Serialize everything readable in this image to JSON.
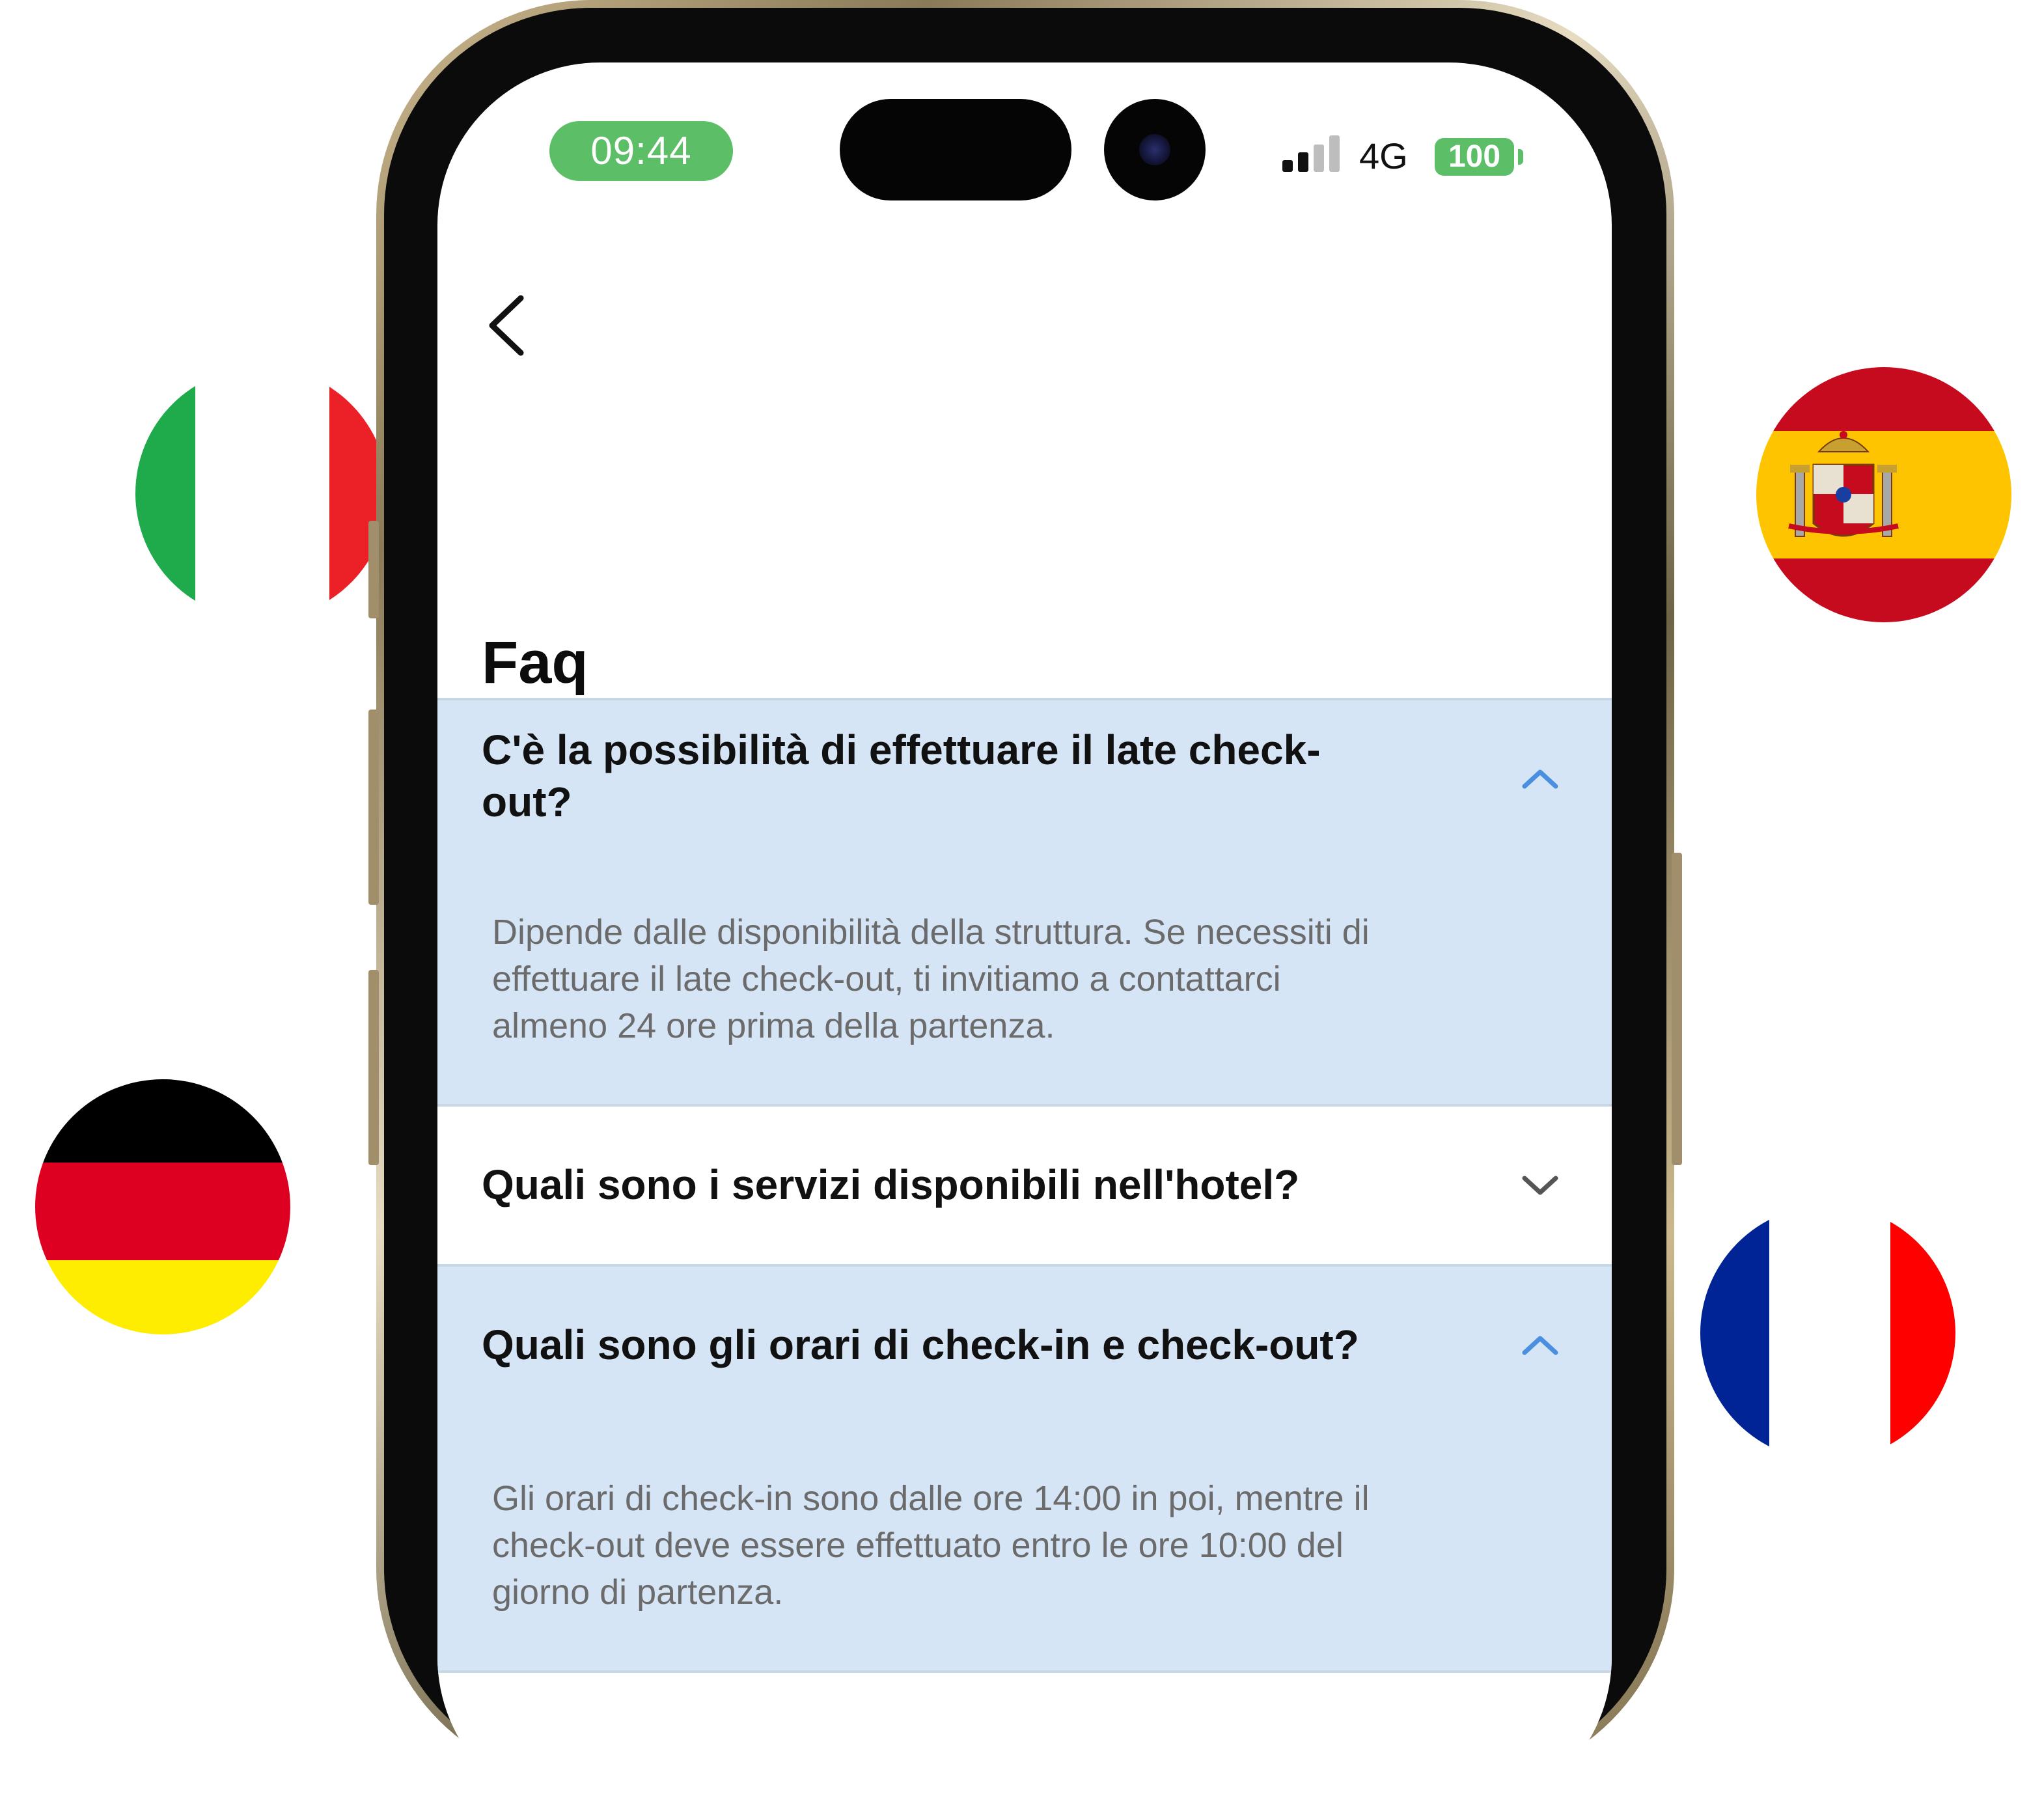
{
  "status_bar": {
    "time": "09:44",
    "network": "4G",
    "battery": "100"
  },
  "page": {
    "title": "Faq"
  },
  "faq": {
    "items": [
      {
        "question_line1": "C'è la possibilità di effettuare il late check-",
        "question_line2": "out?",
        "answer_line1": "Dipende dalle disponibilità della struttura. Se necessiti di",
        "answer_line2": "effettuare il late check-out, ti invitiamo a contattarci",
        "answer_line3": "almeno 24 ore prima della partenza.",
        "state": "expanded"
      },
      {
        "question": "Quali sono i servizi disponibili nell'hotel?",
        "state": "collapsed"
      },
      {
        "question": "Quali sono gli orari di check-in e check-out?",
        "answer_line1": "Gli orari di check-in sono dalle ore 14:00 in poi, mentre il",
        "answer_line2": "check-out deve essere effettuato entro le ore 10:00 del",
        "answer_line3": "giorno di partenza.",
        "state": "expanded"
      }
    ]
  },
  "colors": {
    "accent_blue": "#4a8fe0",
    "expanded_background": "#d5e5f5",
    "status_green": "#5cbf67"
  },
  "decorations": {
    "flags": [
      "italy-flag",
      "spain-flag",
      "germany-flag",
      "france-flag"
    ]
  }
}
